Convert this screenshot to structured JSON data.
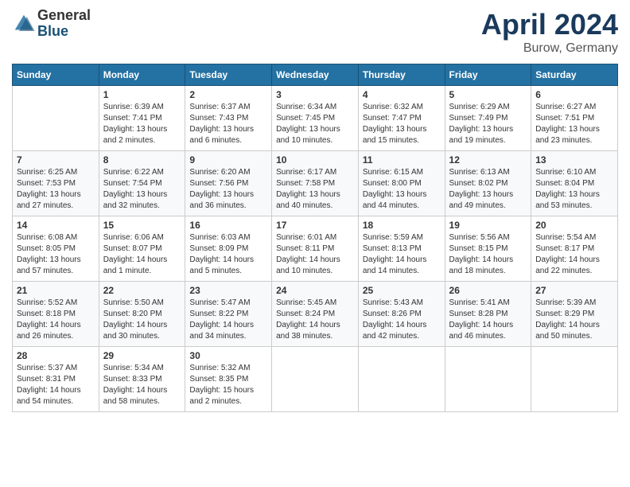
{
  "header": {
    "logo_general": "General",
    "logo_blue": "Blue",
    "month": "April 2024",
    "location": "Burow, Germany"
  },
  "weekdays": [
    "Sunday",
    "Monday",
    "Tuesday",
    "Wednesday",
    "Thursday",
    "Friday",
    "Saturday"
  ],
  "weeks": [
    [
      {
        "num": "",
        "info": ""
      },
      {
        "num": "1",
        "info": "Sunrise: 6:39 AM\nSunset: 7:41 PM\nDaylight: 13 hours\nand 2 minutes."
      },
      {
        "num": "2",
        "info": "Sunrise: 6:37 AM\nSunset: 7:43 PM\nDaylight: 13 hours\nand 6 minutes."
      },
      {
        "num": "3",
        "info": "Sunrise: 6:34 AM\nSunset: 7:45 PM\nDaylight: 13 hours\nand 10 minutes."
      },
      {
        "num": "4",
        "info": "Sunrise: 6:32 AM\nSunset: 7:47 PM\nDaylight: 13 hours\nand 15 minutes."
      },
      {
        "num": "5",
        "info": "Sunrise: 6:29 AM\nSunset: 7:49 PM\nDaylight: 13 hours\nand 19 minutes."
      },
      {
        "num": "6",
        "info": "Sunrise: 6:27 AM\nSunset: 7:51 PM\nDaylight: 13 hours\nand 23 minutes."
      }
    ],
    [
      {
        "num": "7",
        "info": "Sunrise: 6:25 AM\nSunset: 7:53 PM\nDaylight: 13 hours\nand 27 minutes."
      },
      {
        "num": "8",
        "info": "Sunrise: 6:22 AM\nSunset: 7:54 PM\nDaylight: 13 hours\nand 32 minutes."
      },
      {
        "num": "9",
        "info": "Sunrise: 6:20 AM\nSunset: 7:56 PM\nDaylight: 13 hours\nand 36 minutes."
      },
      {
        "num": "10",
        "info": "Sunrise: 6:17 AM\nSunset: 7:58 PM\nDaylight: 13 hours\nand 40 minutes."
      },
      {
        "num": "11",
        "info": "Sunrise: 6:15 AM\nSunset: 8:00 PM\nDaylight: 13 hours\nand 44 minutes."
      },
      {
        "num": "12",
        "info": "Sunrise: 6:13 AM\nSunset: 8:02 PM\nDaylight: 13 hours\nand 49 minutes."
      },
      {
        "num": "13",
        "info": "Sunrise: 6:10 AM\nSunset: 8:04 PM\nDaylight: 13 hours\nand 53 minutes."
      }
    ],
    [
      {
        "num": "14",
        "info": "Sunrise: 6:08 AM\nSunset: 8:05 PM\nDaylight: 13 hours\nand 57 minutes."
      },
      {
        "num": "15",
        "info": "Sunrise: 6:06 AM\nSunset: 8:07 PM\nDaylight: 14 hours\nand 1 minute."
      },
      {
        "num": "16",
        "info": "Sunrise: 6:03 AM\nSunset: 8:09 PM\nDaylight: 14 hours\nand 5 minutes."
      },
      {
        "num": "17",
        "info": "Sunrise: 6:01 AM\nSunset: 8:11 PM\nDaylight: 14 hours\nand 10 minutes."
      },
      {
        "num": "18",
        "info": "Sunrise: 5:59 AM\nSunset: 8:13 PM\nDaylight: 14 hours\nand 14 minutes."
      },
      {
        "num": "19",
        "info": "Sunrise: 5:56 AM\nSunset: 8:15 PM\nDaylight: 14 hours\nand 18 minutes."
      },
      {
        "num": "20",
        "info": "Sunrise: 5:54 AM\nSunset: 8:17 PM\nDaylight: 14 hours\nand 22 minutes."
      }
    ],
    [
      {
        "num": "21",
        "info": "Sunrise: 5:52 AM\nSunset: 8:18 PM\nDaylight: 14 hours\nand 26 minutes."
      },
      {
        "num": "22",
        "info": "Sunrise: 5:50 AM\nSunset: 8:20 PM\nDaylight: 14 hours\nand 30 minutes."
      },
      {
        "num": "23",
        "info": "Sunrise: 5:47 AM\nSunset: 8:22 PM\nDaylight: 14 hours\nand 34 minutes."
      },
      {
        "num": "24",
        "info": "Sunrise: 5:45 AM\nSunset: 8:24 PM\nDaylight: 14 hours\nand 38 minutes."
      },
      {
        "num": "25",
        "info": "Sunrise: 5:43 AM\nSunset: 8:26 PM\nDaylight: 14 hours\nand 42 minutes."
      },
      {
        "num": "26",
        "info": "Sunrise: 5:41 AM\nSunset: 8:28 PM\nDaylight: 14 hours\nand 46 minutes."
      },
      {
        "num": "27",
        "info": "Sunrise: 5:39 AM\nSunset: 8:29 PM\nDaylight: 14 hours\nand 50 minutes."
      }
    ],
    [
      {
        "num": "28",
        "info": "Sunrise: 5:37 AM\nSunset: 8:31 PM\nDaylight: 14 hours\nand 54 minutes."
      },
      {
        "num": "29",
        "info": "Sunrise: 5:34 AM\nSunset: 8:33 PM\nDaylight: 14 hours\nand 58 minutes."
      },
      {
        "num": "30",
        "info": "Sunrise: 5:32 AM\nSunset: 8:35 PM\nDaylight: 15 hours\nand 2 minutes."
      },
      {
        "num": "",
        "info": ""
      },
      {
        "num": "",
        "info": ""
      },
      {
        "num": "",
        "info": ""
      },
      {
        "num": "",
        "info": ""
      }
    ]
  ]
}
